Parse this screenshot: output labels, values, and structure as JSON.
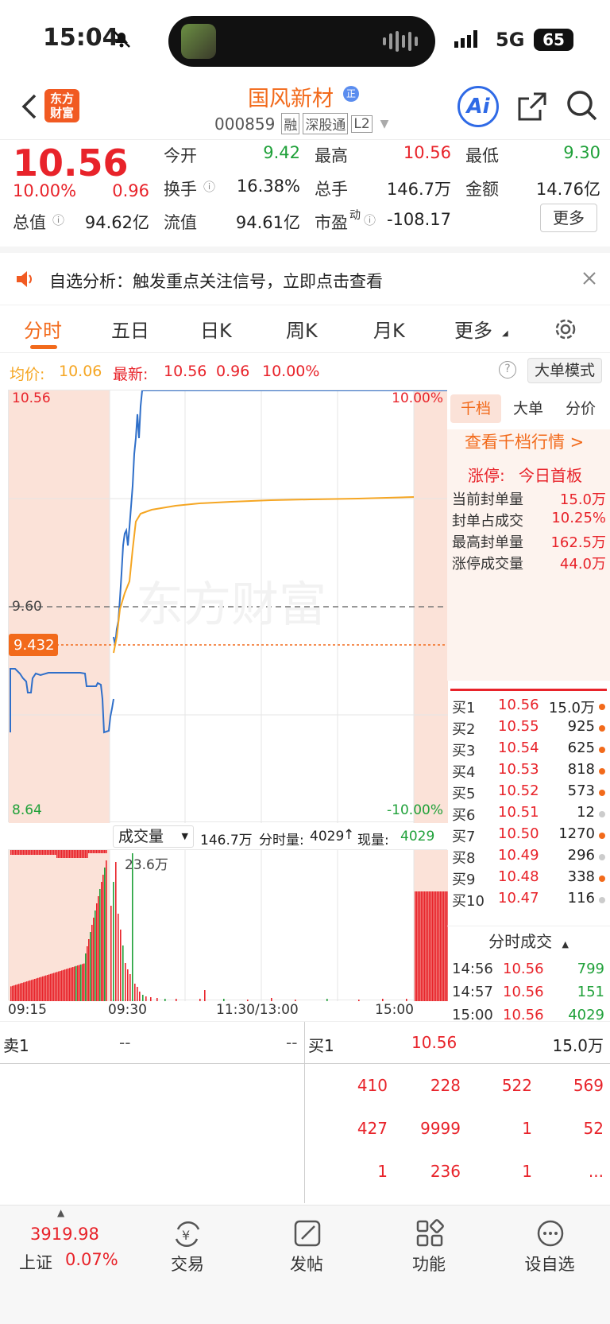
{
  "status": {
    "time": "15:04",
    "network": "5G",
    "battery": "65"
  },
  "header": {
    "logo_line1": "东方",
    "logo_line2": "财富",
    "stock_name": "国风新材",
    "tag": "正",
    "code": "000859",
    "badges": [
      "融",
      "深股通",
      "L2"
    ],
    "ai": "Ai"
  },
  "quote": {
    "price": "10.56",
    "change_pct": "10.00%",
    "change": "0.96",
    "open_label": "今开",
    "open": "9.42",
    "high_label": "最高",
    "high": "10.56",
    "low_label": "最低",
    "low": "9.30",
    "turnover_label": "换手",
    "turnover": "16.38%",
    "volume_label": "总手",
    "volume": "146.7万",
    "amount_label": "金额",
    "amount": "14.76亿",
    "mktcap_label": "总值",
    "mktcap": "94.62亿",
    "float_label": "流值",
    "float": "94.61亿",
    "pe_label": "市盈",
    "pe_sup": "动",
    "pe": "-108.17",
    "more": "更多"
  },
  "alert": {
    "text": "自选分析：触发重点关注信号，立即点击查看"
  },
  "tabs": [
    "分时",
    "五日",
    "日K",
    "周K",
    "月K",
    "更多"
  ],
  "info": {
    "avg_label": "均价:",
    "avg": "10.06",
    "latest_label": "最新:",
    "latest": "10.56",
    "chg": "0.96",
    "pct": "10.00%",
    "mode": "大单模式"
  },
  "chart": {
    "y_top": "10.56",
    "y_bottom": "8.64",
    "y_mid": "9.60",
    "marker": "9.432",
    "pct_top": "10.00%",
    "pct_bottom": "-10.00%",
    "watermark": "东方财富"
  },
  "volbar": {
    "label": "成交量",
    "total": "146.7万",
    "min_label": "分时量:",
    "min": "4029",
    "now_label": "现量:",
    "now": "4029",
    "peak": "23.6万"
  },
  "timeaxis": [
    "09:15",
    "09:30",
    "11:30/13:00",
    "15:00"
  ],
  "side": {
    "tabs": [
      "千档",
      "大单",
      "分价"
    ],
    "link": "查看千档行情 >",
    "limit_label": "涨停:",
    "limit_val": "今日首板",
    "stats": [
      {
        "label": "当前封单量",
        "value": "15.0万"
      },
      {
        "label": "封单占成交",
        "value": "10.25%"
      },
      {
        "label": "最高封单量",
        "value": "162.5万"
      },
      {
        "label": "涨停成交量",
        "value": "44.0万"
      }
    ],
    "bids": [
      {
        "l": "买1",
        "p": "10.56",
        "v": "15.0万",
        "d": "#f26a1b"
      },
      {
        "l": "买2",
        "p": "10.55",
        "v": "925",
        "d": "#f26a1b"
      },
      {
        "l": "买3",
        "p": "10.54",
        "v": "625",
        "d": "#f26a1b"
      },
      {
        "l": "买4",
        "p": "10.53",
        "v": "818",
        "d": "#f26a1b"
      },
      {
        "l": "买5",
        "p": "10.52",
        "v": "573",
        "d": "#f26a1b"
      },
      {
        "l": "买6",
        "p": "10.51",
        "v": "12",
        "d": "#cccccc"
      },
      {
        "l": "买7",
        "p": "10.50",
        "v": "1270",
        "d": "#f26a1b"
      },
      {
        "l": "买8",
        "p": "10.49",
        "v": "296",
        "d": "#cccccc"
      },
      {
        "l": "买9",
        "p": "10.48",
        "v": "338",
        "d": "#f26a1b"
      },
      {
        "l": "买10",
        "p": "10.47",
        "v": "116",
        "d": "#cccccc"
      }
    ],
    "trades_label": "分时成交",
    "trades": [
      {
        "t": "14:56",
        "p": "10.56",
        "v": "799"
      },
      {
        "t": "14:57",
        "p": "10.56",
        "v": "151"
      },
      {
        "t": "15:00",
        "p": "10.56",
        "v": "4029"
      }
    ]
  },
  "table": {
    "sell_label": "卖1",
    "sell_p": "--",
    "sell_v": "--",
    "buy_label": "买1",
    "buy_p": "10.56",
    "buy_v": "15.0万",
    "rows": [
      [
        "410",
        "228",
        "522",
        "569"
      ],
      [
        "427",
        "9999",
        "1",
        "52"
      ],
      [
        "1",
        "236",
        "1",
        "..."
      ]
    ]
  },
  "nav": {
    "index_val": "3919.98",
    "index_name": "上证",
    "index_pct": "0.07%",
    "items": [
      "交易",
      "发帖",
      "功能",
      "设自选"
    ]
  }
}
